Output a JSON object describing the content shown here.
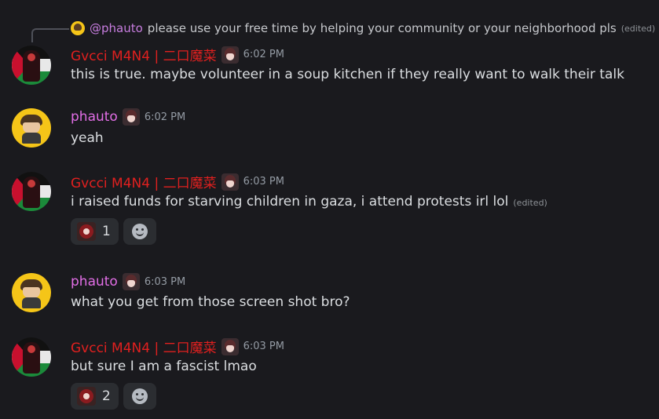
{
  "reply": {
    "mention": "@phauto",
    "text": "please  use your free time by helping your community or your neighborhood pls",
    "edited": "(edited)"
  },
  "messages": [
    {
      "author": "Gvcci M4N4 | 二口魔菜",
      "author_color": "#e0201f",
      "time": "6:02 PM",
      "text": "this is true. maybe volunteer in a soup kitchen if they really want to walk their talk"
    },
    {
      "author": "phauto",
      "author_color": "#e26ee6",
      "time": "6:02 PM",
      "text": "yeah"
    },
    {
      "author": "Gvcci M4N4 | 二口魔菜",
      "author_color": "#e0201f",
      "time": "6:03 PM",
      "text": "i raised funds for starving children in gaza, i attend protests irl lol",
      "edited": "(edited)",
      "reaction_count": "1"
    },
    {
      "author": "phauto",
      "author_color": "#e26ee6",
      "time": "6:03 PM",
      "text": "what you get from those screen shot bro?"
    },
    {
      "author": "Gvcci M4N4 | 二口魔菜",
      "author_color": "#e0201f",
      "time": "6:03 PM",
      "text": "but sure I am a fascist lmao",
      "reaction_count": "2"
    }
  ],
  "icons": {
    "add_reaction": "smile-plus-icon",
    "role_badge": "anime-girl-badge-icon"
  }
}
